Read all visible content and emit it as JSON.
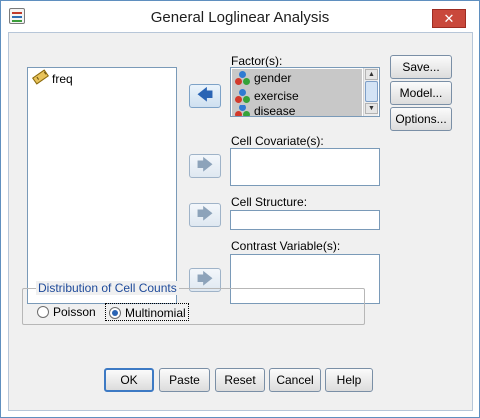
{
  "window": {
    "title": "General Loglinear Analysis",
    "close_glyph": "✕"
  },
  "variables": {
    "items": [
      {
        "name": "freq",
        "icon": "ruler-icon"
      }
    ]
  },
  "factors": {
    "label": "Factor(s):",
    "items": [
      {
        "name": "gender",
        "icon": "nominal-balls-icon"
      },
      {
        "name": "exercise",
        "icon": "nominal-balls-icon"
      },
      {
        "name": "disease",
        "icon": "nominal-balls-icon"
      }
    ]
  },
  "cell_covariates": {
    "label": "Cell Covariate(s):"
  },
  "cell_structure": {
    "label": "Cell Structure:"
  },
  "contrast_variables": {
    "label": "Contrast Variable(s):"
  },
  "arrows": {
    "glyph_left": "🡄",
    "glyph_right": "🡆"
  },
  "side_buttons": {
    "save": "Save...",
    "model": "Model...",
    "options": "Options..."
  },
  "distribution": {
    "label": "Distribution of Cell Counts",
    "options": [
      {
        "label": "Poisson",
        "checked": false
      },
      {
        "label": "Multinomial",
        "checked": true
      }
    ]
  },
  "bottom_buttons": {
    "ok": "OK",
    "paste": "Paste",
    "reset": "Reset",
    "cancel": "Cancel",
    "help": "Help"
  },
  "colors": {
    "accent": "#2a64b4",
    "close": "#c9483b",
    "group_label": "#1e4a9a"
  }
}
